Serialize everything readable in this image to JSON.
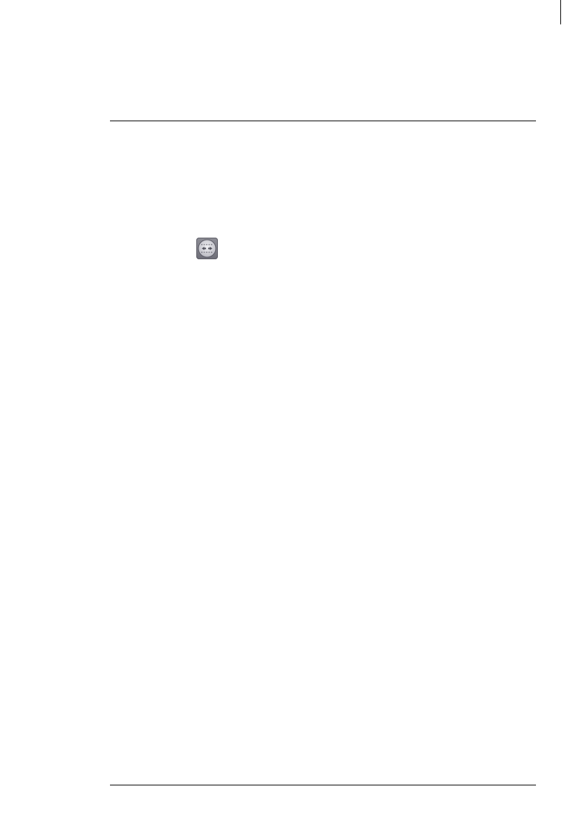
{
  "page": {
    "icons": {
      "crop_mark": "crop-mark",
      "expand_horizontal": "expand-horizontal-icon"
    },
    "colors": {
      "rule": "#000000",
      "icon_background": "#7a7a84",
      "icon_face": "#d9d9dd",
      "icon_arrows": "#55555f"
    }
  }
}
